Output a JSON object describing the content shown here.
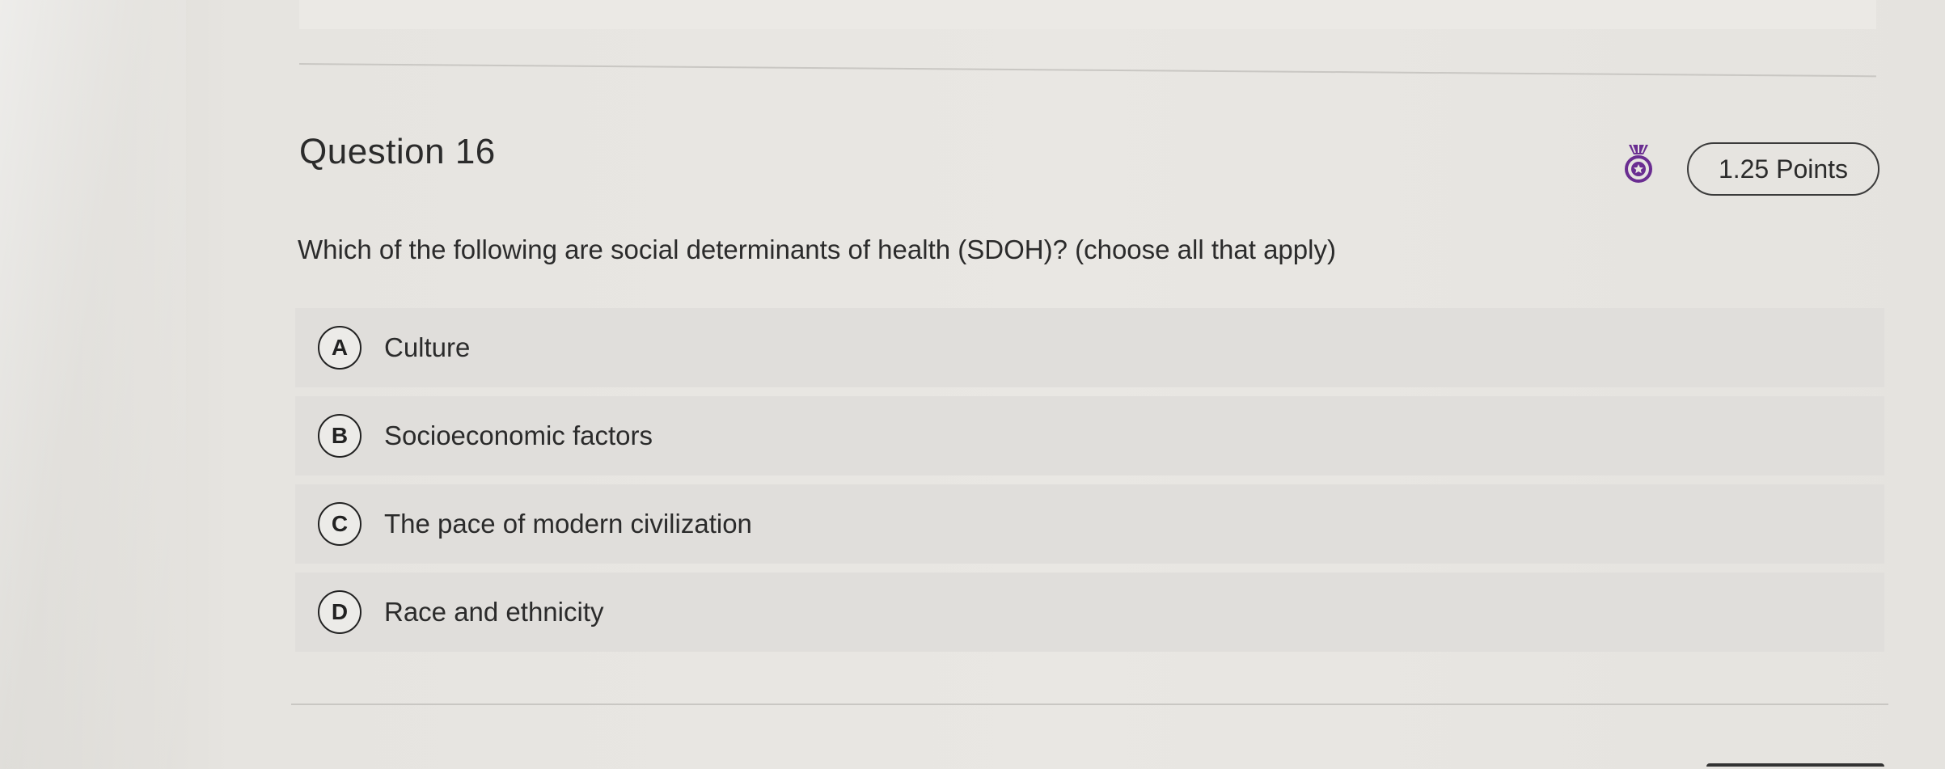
{
  "question": {
    "title": "Question 16",
    "points": "1.25 Points",
    "prompt": "Which of the following are social determinants of health (SDOH)? (choose all that apply)"
  },
  "options": [
    {
      "letter": "A",
      "text": "Culture"
    },
    {
      "letter": "B",
      "text": "Socioeconomic factors"
    },
    {
      "letter": "C",
      "text": "The pace of modern civilization"
    },
    {
      "letter": "D",
      "text": "Race and ethnicity"
    }
  ],
  "icons": {
    "badge": "award-medal-icon"
  },
  "colors": {
    "badge_purple": "#6a2d91",
    "text": "#2b2b2b",
    "option_bg": "#e0dedb"
  }
}
